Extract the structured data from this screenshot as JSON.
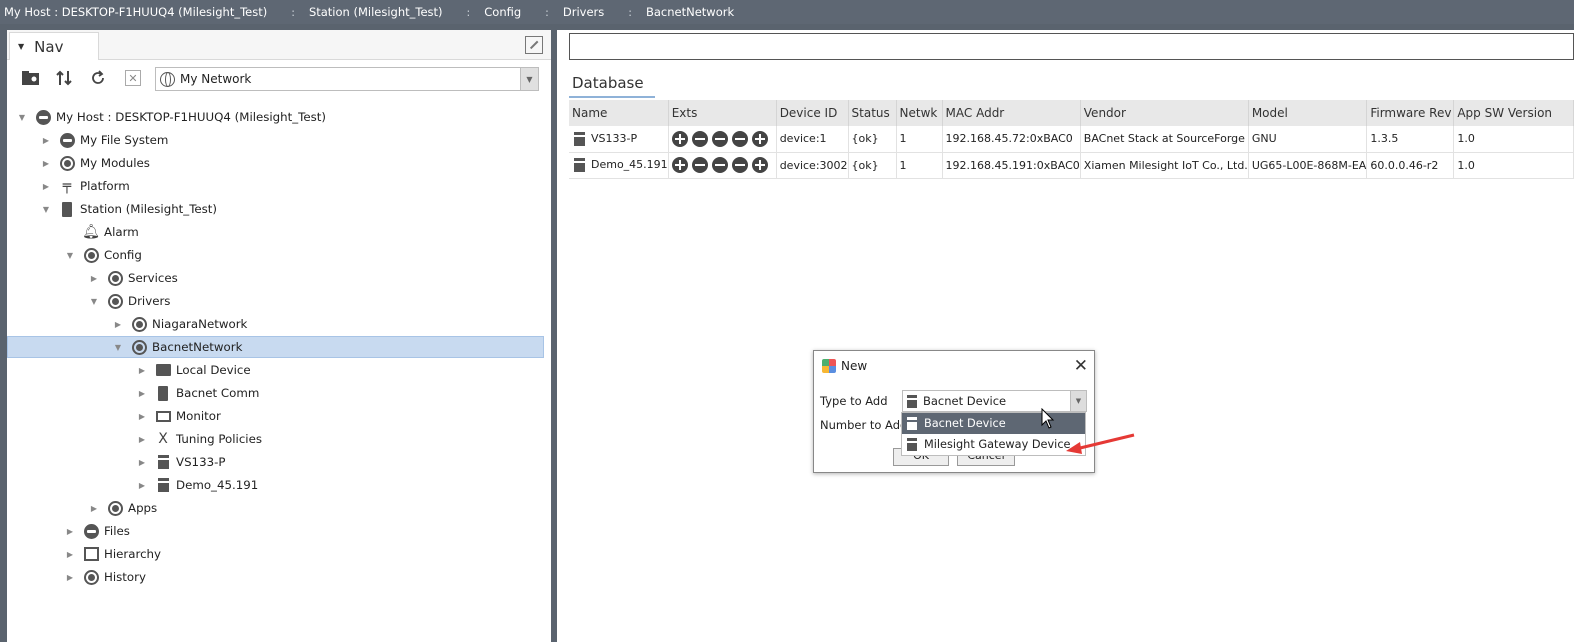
{
  "breadcrumb": [
    {
      "label": "My Host : DESKTOP-F1HUUQ4 (Milesight_Test)"
    },
    {
      "label": "Station (Milesight_Test)"
    },
    {
      "label": "Config"
    },
    {
      "label": "Drivers"
    },
    {
      "label": "BacnetNetwork"
    }
  ],
  "nav": {
    "tab_label": "Nav",
    "network_select": "My Network",
    "tree": [
      {
        "label": "My Host : DESKTOP-F1HUUQ4 (Milesight_Test)",
        "icon": "host-icon"
      },
      {
        "label": "My File System",
        "icon": "disk-icon"
      },
      {
        "label": "My Modules",
        "icon": "modules-icon"
      },
      {
        "label": "Platform",
        "icon": "platform-icon"
      },
      {
        "label": "Station (Milesight_Test)",
        "icon": "station-icon"
      },
      {
        "label": "Alarm",
        "icon": "bell-icon"
      },
      {
        "label": "Config",
        "icon": "database-icon"
      },
      {
        "label": "Services",
        "icon": "services-icon"
      },
      {
        "label": "Drivers",
        "icon": "drivers-icon"
      },
      {
        "label": "NiagaraNetwork",
        "icon": "network-icon"
      },
      {
        "label": "BacnetNetwork",
        "icon": "network-icon"
      },
      {
        "label": "Local Device",
        "icon": "local-device-icon"
      },
      {
        "label": "Bacnet Comm",
        "icon": "comm-icon"
      },
      {
        "label": "Monitor",
        "icon": "monitor-icon"
      },
      {
        "label": "Tuning Policies",
        "icon": "tuning-icon"
      },
      {
        "label": "VS133-P",
        "icon": "device-icon"
      },
      {
        "label": "Demo_45.191",
        "icon": "device-icon"
      },
      {
        "label": "Apps",
        "icon": "apps-icon"
      },
      {
        "label": "Files",
        "icon": "files-icon"
      },
      {
        "label": "Hierarchy",
        "icon": "hierarchy-icon"
      },
      {
        "label": "History",
        "icon": "history-icon"
      }
    ]
  },
  "database": {
    "tab_label": "Database",
    "columns": [
      "Name",
      "Exts",
      "Device ID",
      "Status",
      "Netwk",
      "MAC Addr",
      "Vendor",
      "Model",
      "Firmware Rev",
      "App SW Version"
    ],
    "rows": [
      {
        "name": "VS133-P",
        "device_id": "device:1",
        "status": "{ok}",
        "netwk": "1",
        "mac": "192.168.45.72:0xBAC0",
        "vendor": "BACnet Stack at SourceForge",
        "model": "GNU",
        "firmware": "1.3.5",
        "app_sw": "1.0"
      },
      {
        "name": "Demo_45.191",
        "device_id": "device:3002",
        "status": "{ok}",
        "netwk": "1",
        "mac": "192.168.45.191:0xBAC0",
        "vendor": "Xiamen Milesight IoT Co., Ltd.",
        "model": "UG65-L00E-868M-EA",
        "firmware": "60.0.0.46-r2",
        "app_sw": "1.0"
      }
    ]
  },
  "dialog": {
    "title": "New",
    "type_label": "Type to Add",
    "number_label": "Number to Add",
    "type_value": "Bacnet Device",
    "ok_label": "OK",
    "cancel_label": "Cancel",
    "options": [
      "Bacnet Device",
      "Milesight Gateway Device"
    ]
  },
  "colors": {
    "topbar": "#5e6773",
    "selection": "#c8daf0",
    "annotation_arrow": "#e53935"
  }
}
